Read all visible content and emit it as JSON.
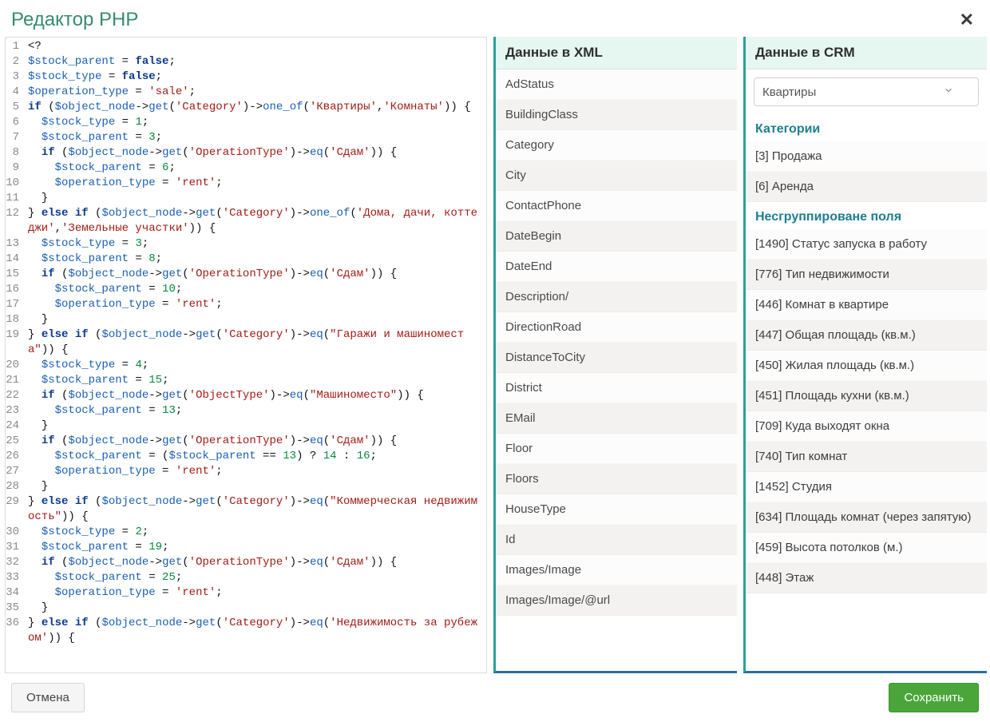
{
  "header": {
    "title": "Редактор PHP",
    "close_label": "✕"
  },
  "code": {
    "lines": [
      "<?",
      "$stock_parent = false;",
      "$stock_type = false;",
      "$operation_type = 'sale';",
      "if ($object_node->get('Category')->one_of('Квартиры','Комнаты')) {",
      "  $stock_type = 1;",
      "  $stock_parent = 3;",
      "  if ($object_node->get('OperationType')->eq('Сдам')) {",
      "    $stock_parent = 6;",
      "    $operation_type = 'rent';",
      "  }",
      "} else if ($object_node->get('Category')->one_of('Дома, дачи, коттеджи','Земельные участки')) {",
      "  $stock_type = 3;",
      "  $stock_parent = 8;",
      "  if ($object_node->get('OperationType')->eq('Сдам')) {",
      "    $stock_parent = 10;",
      "    $operation_type = 'rent';",
      "  }",
      "} else if ($object_node->get('Category')->eq(\"Гаражи и машиноместа\")) {",
      "  $stock_type = 4;",
      "  $stock_parent = 15;",
      "  if ($object_node->get('ObjectType')->eq(\"Машиноместо\")) {",
      "    $stock_parent = 13;",
      "  }",
      "  if ($object_node->get('OperationType')->eq('Сдам')) {",
      "    $stock_parent = ($stock_parent == 13) ? 14 : 16;",
      "    $operation_type = 'rent';",
      "  }",
      "} else if ($object_node->get('Category')->eq(\"Коммерческая недвижимость\")) {",
      "  $stock_type = 2;",
      "  $stock_parent = 19;",
      "  if ($object_node->get('OperationType')->eq('Сдам')) {",
      "    $stock_parent = 25;",
      "    $operation_type = 'rent';",
      "  }",
      "} else if ($object_node->get('Category')->eq('Недвижимость за рубежом')) {"
    ]
  },
  "xml_panel": {
    "title": "Данные в XML",
    "items": [
      "AdStatus",
      "BuildingClass",
      "Category",
      "City",
      "ContactPhone",
      "DateBegin",
      "DateEnd",
      "Description/",
      "DirectionRoad",
      "DistanceToCity",
      "District",
      "EMail",
      "Floor",
      "Floors",
      "HouseType",
      "Id",
      "Images/Image",
      "Images/Image/@url"
    ]
  },
  "crm_panel": {
    "title": "Данные в CRM",
    "select_value": "Квартиры",
    "section_categories_title": "Категории",
    "categories": [
      "[3] Продажа",
      "[6] Аренда"
    ],
    "section_fields_title": "Несгруппироване поля",
    "fields": [
      "[1490] Статус запуска в работу",
      "[776] Тип недвижимости",
      "[446] Комнат в квартире",
      "[447] Общая площадь (кв.м.)",
      "[450] Жилая площадь (кв.м.)",
      "[451] Площадь кухни (кв.м.)",
      "[709] Куда выходят окна",
      "[740] Тип комнат",
      "[1452] Студия",
      "[634] Площадь комнат (через запятую)",
      "[459] Высота потолков (м.)",
      "[448] Этаж"
    ]
  },
  "footer": {
    "cancel": "Отмена",
    "save": "Сохранить"
  }
}
